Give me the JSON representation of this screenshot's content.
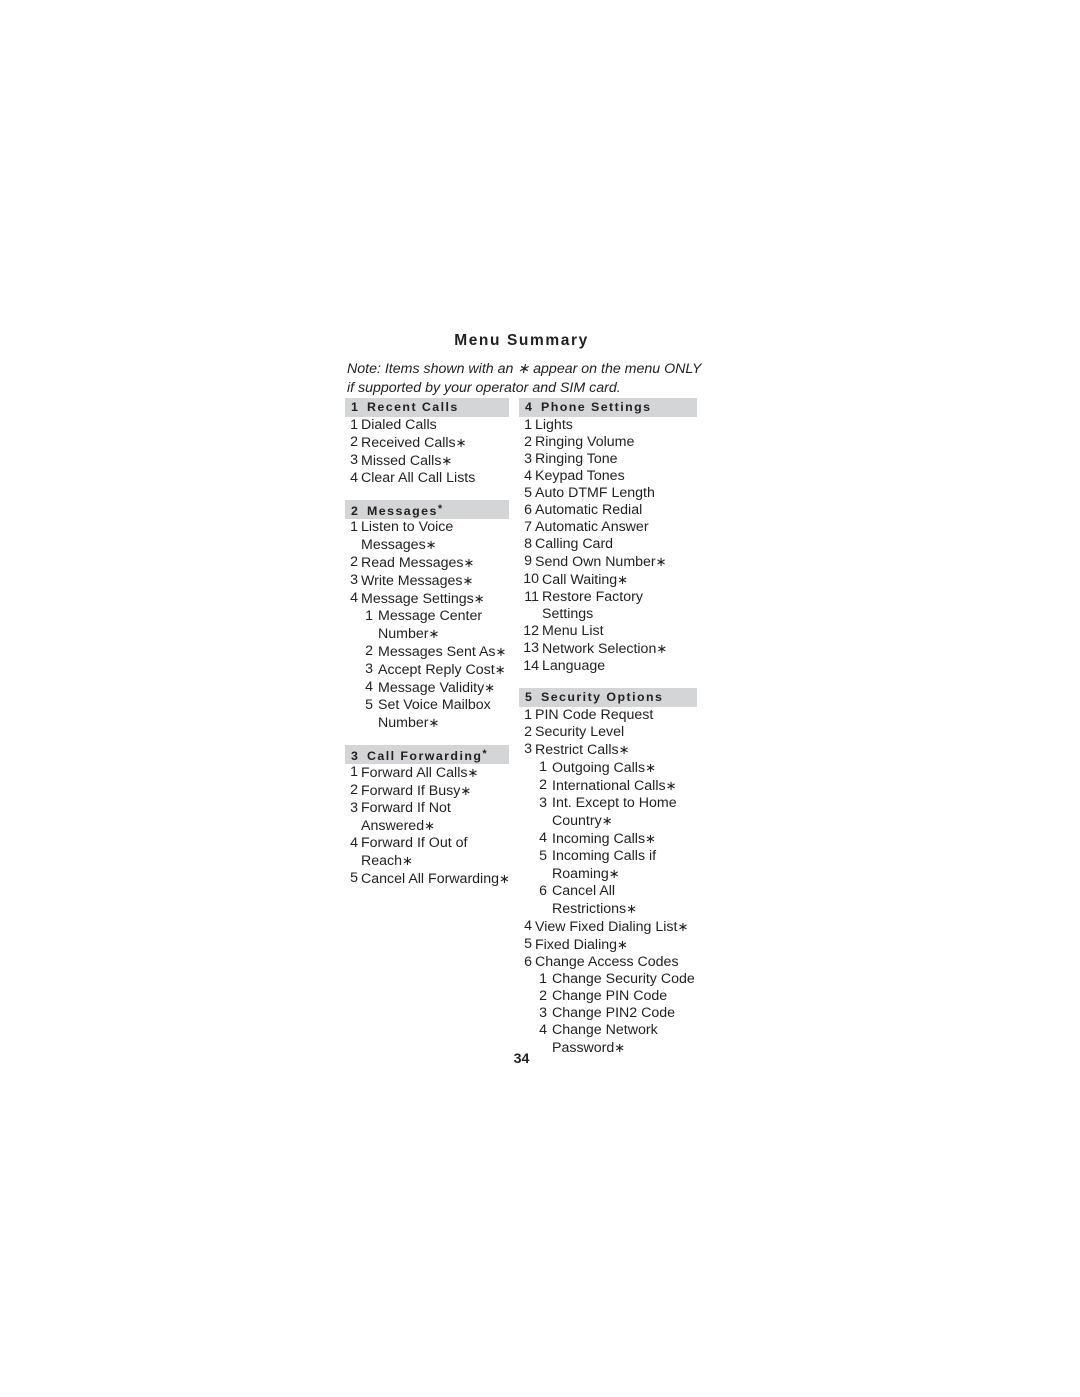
{
  "document": {
    "title": "Menu Summary",
    "note_lines": [
      "Note: Items shown with an ∗ appear on the menu ONLY",
      "if supported by your operator and SIM card."
    ],
    "page_number": "34",
    "asterisk_glyph": "∗",
    "header_bg_color": "#d4d5d7",
    "text_color": "#231f20"
  },
  "columns": {
    "left": [
      {
        "number": "1",
        "title": "Recent Calls",
        "title_starred": false,
        "items": [
          {
            "num": "1",
            "label": "Dialed Calls",
            "starred": false,
            "depth": 0
          },
          {
            "num": "2",
            "label": "Received Calls",
            "starred": true,
            "depth": 0
          },
          {
            "num": "3",
            "label": "Missed Calls",
            "starred": true,
            "depth": 0
          },
          {
            "num": "4",
            "label": "Clear All Call Lists",
            "starred": false,
            "depth": 0
          }
        ]
      },
      {
        "number": "2",
        "title": "Messages",
        "title_starred": true,
        "items": [
          {
            "num": "1",
            "label": "Listen to Voice Messages",
            "starred": true,
            "depth": 0
          },
          {
            "num": "2",
            "label": "Read Messages",
            "starred": true,
            "depth": 0
          },
          {
            "num": "3",
            "label": "Write Messages",
            "starred": true,
            "depth": 0
          },
          {
            "num": "4",
            "label": "Message Settings",
            "starred": true,
            "depth": 0
          },
          {
            "num": "1",
            "label": "Message Center Number",
            "starred": true,
            "depth": 1
          },
          {
            "num": "2",
            "label": "Messages Sent As",
            "starred": true,
            "depth": 1
          },
          {
            "num": "3",
            "label": "Accept Reply Cost",
            "starred": true,
            "depth": 1
          },
          {
            "num": "4",
            "label": "Message Validity",
            "starred": true,
            "depth": 1
          },
          {
            "num": "5",
            "label": "Set Voice Mailbox Number",
            "starred": true,
            "depth": 1
          }
        ]
      },
      {
        "number": "3",
        "title": "Call Forwarding",
        "title_starred": true,
        "items": [
          {
            "num": "1",
            "label": "Forward All Calls",
            "starred": true,
            "depth": 0
          },
          {
            "num": "2",
            "label": "Forward If Busy",
            "starred": true,
            "depth": 0
          },
          {
            "num": "3",
            "label": "Forward If Not Answered",
            "starred": true,
            "depth": 0
          },
          {
            "num": "4",
            "label": "Forward If Out of Reach",
            "starred": true,
            "depth": 0
          },
          {
            "num": "5",
            "label": "Cancel All Forwarding",
            "starred": true,
            "depth": 0
          }
        ]
      }
    ],
    "right": [
      {
        "number": "4",
        "title": "Phone Settings",
        "title_starred": false,
        "items": [
          {
            "num": "1",
            "label": "Lights",
            "starred": false,
            "depth": 0
          },
          {
            "num": "2",
            "label": "Ringing Volume",
            "starred": false,
            "depth": 0
          },
          {
            "num": "3",
            "label": "Ringing Tone",
            "starred": false,
            "depth": 0
          },
          {
            "num": "4",
            "label": "Keypad Tones",
            "starred": false,
            "depth": 0
          },
          {
            "num": "5",
            "label": "Auto DTMF Length",
            "starred": false,
            "depth": 0
          },
          {
            "num": "6",
            "label": "Automatic Redial",
            "starred": false,
            "depth": 0
          },
          {
            "num": "7",
            "label": "Automatic Answer",
            "starred": false,
            "depth": 0
          },
          {
            "num": "8",
            "label": "Calling Card",
            "starred": false,
            "depth": 0
          },
          {
            "num": "9",
            "label": "Send Own Number",
            "starred": true,
            "depth": 0
          },
          {
            "num": "10",
            "label": "Call Waiting",
            "starred": true,
            "depth": 0,
            "wide": true
          },
          {
            "num": "11",
            "label": "Restore Factory Settings",
            "starred": false,
            "depth": 0,
            "wide": true
          },
          {
            "num": "12",
            "label": "Menu List",
            "starred": false,
            "depth": 0,
            "wide": true
          },
          {
            "num": "13",
            "label": "Network Selection",
            "starred": true,
            "depth": 0,
            "wide": true
          },
          {
            "num": "14",
            "label": "Language",
            "starred": false,
            "depth": 0,
            "wide": true
          }
        ]
      },
      {
        "number": "5",
        "title": "Security Options",
        "title_starred": false,
        "items": [
          {
            "num": "1",
            "label": "PIN Code Request",
            "starred": false,
            "depth": 0
          },
          {
            "num": "2",
            "label": "Security Level",
            "starred": false,
            "depth": 0
          },
          {
            "num": "3",
            "label": "Restrict Calls",
            "starred": true,
            "depth": 0
          },
          {
            "num": "1",
            "label": "Outgoing Calls",
            "starred": true,
            "depth": 1
          },
          {
            "num": "2",
            "label": "International Calls",
            "starred": true,
            "depth": 1
          },
          {
            "num": "3",
            "label": "Int. Except to Home Country",
            "starred": true,
            "depth": 1
          },
          {
            "num": "4",
            "label": "Incoming Calls",
            "starred": true,
            "depth": 1
          },
          {
            "num": "5",
            "label": "Incoming Calls if Roaming",
            "starred": true,
            "depth": 1
          },
          {
            "num": "6",
            "label": "Cancel All Restrictions",
            "starred": true,
            "depth": 1
          },
          {
            "num": "4",
            "label": "View Fixed Dialing List",
            "starred": true,
            "depth": 0
          },
          {
            "num": "5",
            "label": "Fixed Dialing",
            "starred": true,
            "depth": 0
          },
          {
            "num": "6",
            "label": "Change Access Codes",
            "starred": false,
            "depth": 0
          },
          {
            "num": "1",
            "label": "Change Security Code",
            "starred": false,
            "depth": 1
          },
          {
            "num": "2",
            "label": "Change PIN Code",
            "starred": false,
            "depth": 1
          },
          {
            "num": "3",
            "label": "Change PIN2 Code",
            "starred": false,
            "depth": 1
          },
          {
            "num": "4",
            "label": "Change Network Password",
            "starred": true,
            "depth": 1
          }
        ]
      }
    ]
  }
}
